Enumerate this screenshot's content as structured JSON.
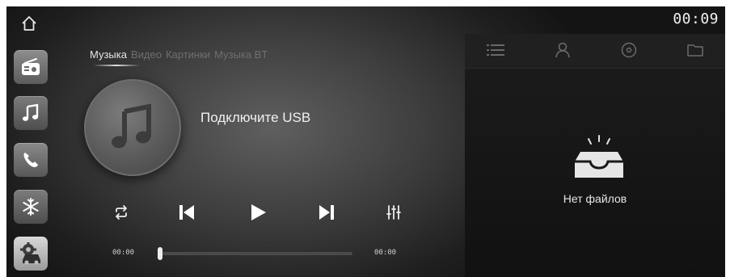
{
  "status_bar": {
    "clock": "00:09"
  },
  "left_rail": {
    "items": [
      {
        "icon": "home-icon"
      },
      {
        "icon": "radio-icon"
      },
      {
        "icon": "music-icon"
      },
      {
        "icon": "phone-icon"
      },
      {
        "icon": "snowflake-icon"
      },
      {
        "icon": "car-settings-icon"
      }
    ]
  },
  "media": {
    "tabs": [
      {
        "label": "Музыка",
        "active": true
      },
      {
        "label": "Видео",
        "active": false
      },
      {
        "label": "Картинки",
        "active": false
      },
      {
        "label": "Музыка BT",
        "active": false
      }
    ],
    "message": "Подключите USB",
    "time_elapsed": "00:00",
    "time_total": "00:00",
    "progress": 0
  },
  "browser": {
    "tabs": [
      {
        "icon": "list-icon"
      },
      {
        "icon": "artist-icon"
      },
      {
        "icon": "album-icon"
      },
      {
        "icon": "folder-icon"
      }
    ],
    "empty_message": "Нет файлов"
  },
  "colors": {
    "text_primary": "#e8e8e8",
    "tab_inactive": "#6f6f6f",
    "panel_bg": "#161616"
  }
}
